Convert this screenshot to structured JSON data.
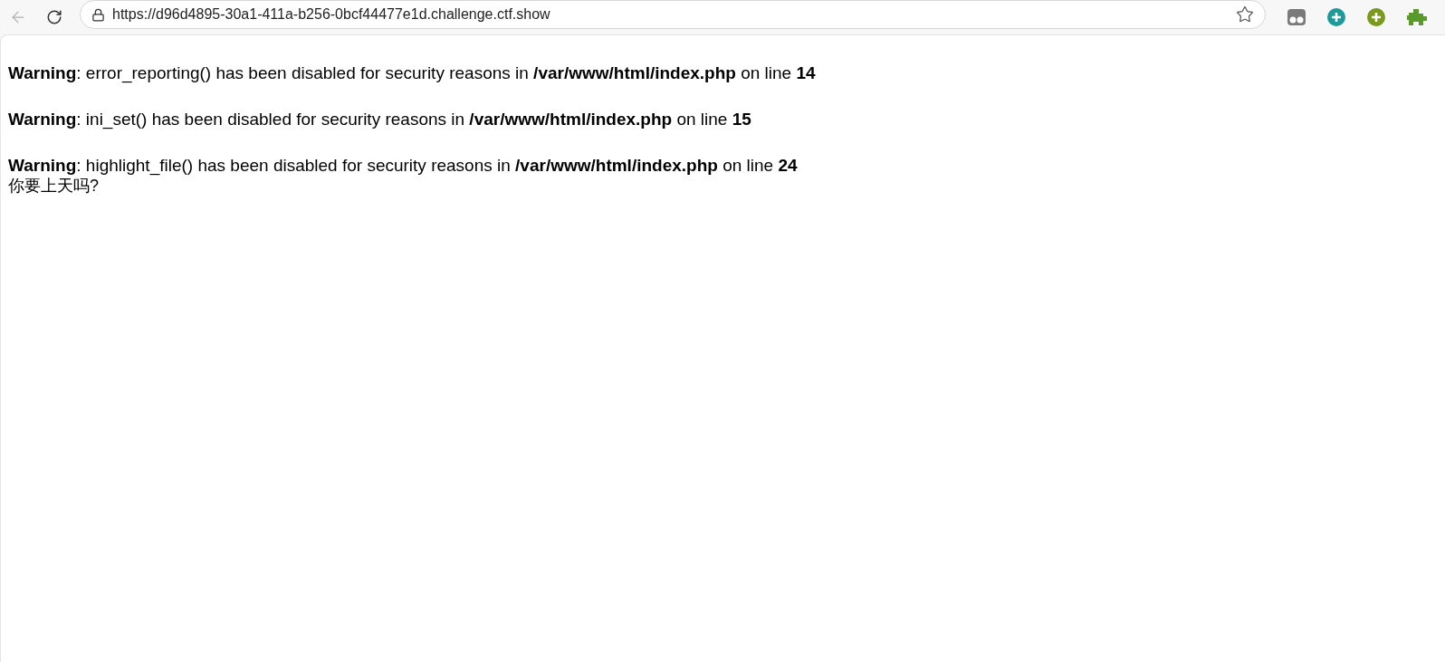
{
  "browser": {
    "url": "https://d96d4895-30a1-411a-b256-0bcf44477e1d.challenge.ctf.show"
  },
  "warnings": [
    "**Warning**: error_reporting() has been disabled for security reasons in **/var/www/html/index.php** on line **14**",
    "**Warning**: ini_set() has been disabled for security reasons in **/var/www/html/index.php** on line **15**",
    "**Warning**: highlight_file() has been disabled for security reasons in **/var/www/html/index.php** on line **24**"
  ],
  "output": "你要上天吗?"
}
